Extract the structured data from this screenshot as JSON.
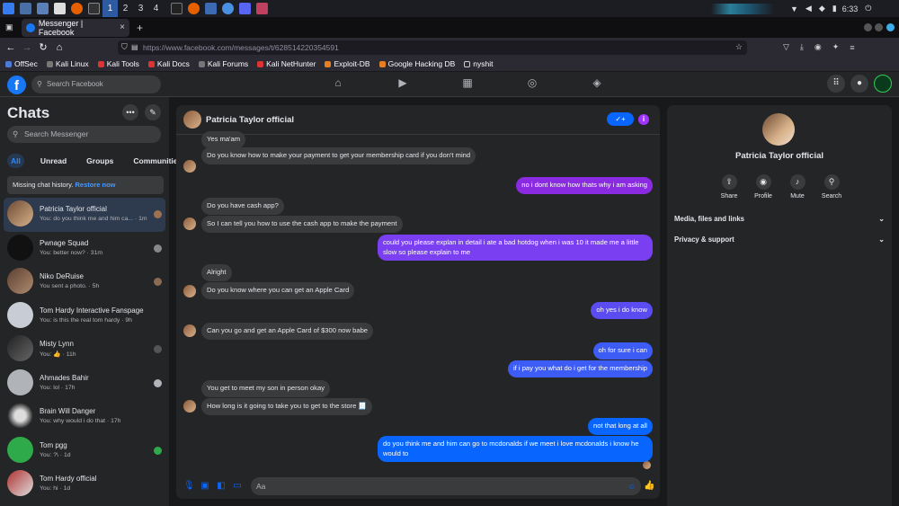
{
  "taskbar": {
    "workspaces": [
      "1",
      "2",
      "3",
      "4"
    ],
    "clock": "6:33"
  },
  "browser": {
    "tab_title": "Messenger | Facebook",
    "new_tab": "+",
    "url": "https://www.facebook.com/messages/t/628514220354591",
    "bookmarks": [
      "OffSec",
      "Kali Linux",
      "Kali Tools",
      "Kali Docs",
      "Kali Forums",
      "Kali NetHunter",
      "Exploit-DB",
      "Google Hacking DB",
      "nyshit"
    ]
  },
  "fb": {
    "logo": "f",
    "search_placeholder": "Search Facebook"
  },
  "sidebar": {
    "title": "Chats",
    "search_placeholder": "Search Messenger",
    "filters": [
      "All",
      "Unread",
      "Groups",
      "Communities"
    ],
    "missing_text": "Missing chat history.",
    "restore_link": "Restore now",
    "chats": [
      {
        "name": "Patricia Taylor official",
        "preview": "You: do you think me and him ca... · 1m"
      },
      {
        "name": "Pwnage Squad",
        "preview": "You: better now? · 31m"
      },
      {
        "name": "Niko DeRuise",
        "preview": "You sent a photo. · 5h"
      },
      {
        "name": "Tom Hardy Interactive Fanspage",
        "preview": "You: is this the real tom hardy · 9h"
      },
      {
        "name": "Misty Lynn",
        "preview": "You: 👍 · 11h"
      },
      {
        "name": "Ahmades Bahir",
        "preview": "You: lol · 17h"
      },
      {
        "name": "Brain Will Danger",
        "preview": "You: why would i do that · 17h"
      },
      {
        "name": "Tom pgg",
        "preview": "You: ?\\ · 1d"
      },
      {
        "name": "Tom Hardy official",
        "preview": "You: hi · 1d"
      }
    ]
  },
  "conversation": {
    "name": "Patricia Taylor official",
    "verify_label": "✓+",
    "info_label": "i",
    "input_placeholder": "Aa",
    "messages": [
      {
        "dir": "in",
        "text": "Yes ma'am"
      },
      {
        "dir": "in",
        "text": "Do you know how to make your payment to get your membership card if you don't mind"
      },
      {
        "dir": "out",
        "text": "no i dont know how thats why i am asking"
      },
      {
        "dir": "in",
        "text": "Do you have cash app?"
      },
      {
        "dir": "in",
        "text": "So I can tell you how to use the cash app to make the payment"
      },
      {
        "dir": "out",
        "text": "could you please explan in detail i ate a bad hotdog when i was 10  it made me a little slow so please explain to me"
      },
      {
        "dir": "in",
        "text": "Alright"
      },
      {
        "dir": "in",
        "text": "Do you know where you can get an Apple Card"
      },
      {
        "dir": "out",
        "text": "oh yes i do know"
      },
      {
        "dir": "in",
        "text": "Can you go and get an Apple Card of $300 now babe"
      },
      {
        "dir": "out",
        "text": "oh for sure i can"
      },
      {
        "dir": "out",
        "text": "if i pay you what do i get for the membership"
      },
      {
        "dir": "in",
        "text": "You get to meet my son in person okay"
      },
      {
        "dir": "in",
        "text": "How long is it going to take you to get to the store 🧾"
      },
      {
        "dir": "out",
        "text": "not that long at all"
      },
      {
        "dir": "out",
        "text": "do you think me and him can go to mcdonalds if we meet i love mcdonalds i know he would to"
      }
    ]
  },
  "profile_panel": {
    "name": "Patricia Taylor official",
    "actions": [
      "Share",
      "Profile",
      "Mute",
      "Search"
    ],
    "sections": [
      "Media, files and links",
      "Privacy & support"
    ]
  },
  "colors": {
    "outgoing_purple": "#8a2be2",
    "outgoing_blue": "#0866ff",
    "accent": "#0866ff"
  }
}
